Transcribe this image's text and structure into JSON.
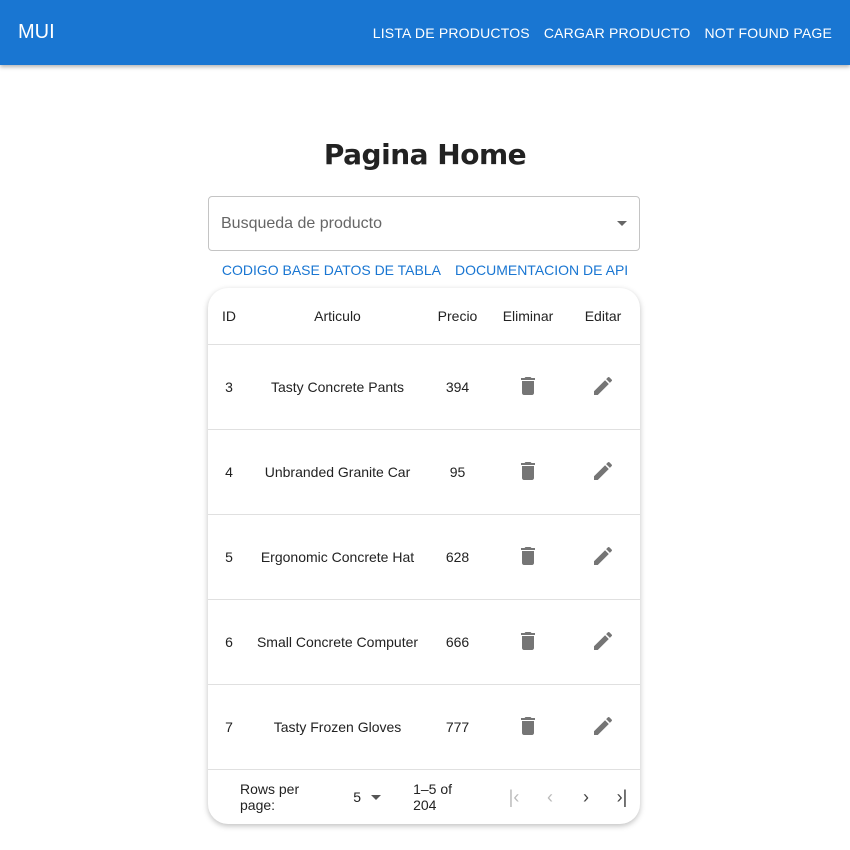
{
  "appbar": {
    "logo": "MUI",
    "nav": [
      "LISTA DE PRODUCTOS",
      "CARGAR PRODUCTO",
      "NOT FOUND PAGE"
    ]
  },
  "page": {
    "title": "Pagina Home"
  },
  "search": {
    "placeholder": "Busqueda de producto"
  },
  "links": [
    "CODIGO BASE DATOS DE TABLA",
    "DOCUMENTACION DE API"
  ],
  "table": {
    "columns": [
      "ID",
      "Articulo",
      "Precio",
      "Eliminar",
      "Editar"
    ],
    "rows": [
      {
        "id": "3",
        "articulo": "Tasty Concrete Pants",
        "precio": "394"
      },
      {
        "id": "4",
        "articulo": "Unbranded Granite Car",
        "precio": "95"
      },
      {
        "id": "5",
        "articulo": "Ergonomic Concrete Hat",
        "precio": "628"
      },
      {
        "id": "6",
        "articulo": "Small Concrete Computer",
        "precio": "666"
      },
      {
        "id": "7",
        "articulo": "Tasty Frozen Gloves",
        "precio": "777"
      }
    ],
    "icons": {
      "delete": "trash-icon",
      "edit": "pencil-icon"
    }
  },
  "pagination": {
    "rows_label": "Rows per page:",
    "rows_value": "5",
    "range": "1–5 of 204"
  },
  "colors": {
    "primary": "#1976d2",
    "icon": "#757575"
  }
}
